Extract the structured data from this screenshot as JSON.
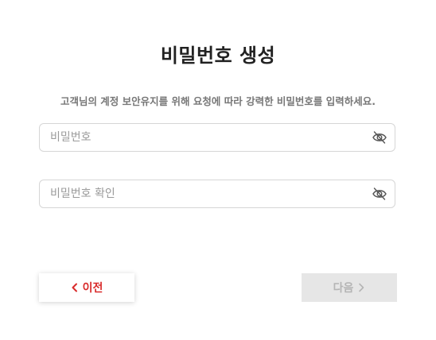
{
  "page": {
    "title": "비밀번호 생성",
    "subtitle": "고객님의 계정 보안유지를 위해 요청에 따라 강력한 비밀번호를 입력하세요."
  },
  "form": {
    "password": {
      "value": "",
      "placeholder": "비밀번호",
      "visibility_icon": "eye-off-icon"
    },
    "password_confirm": {
      "value": "",
      "placeholder": "비밀번호 확인",
      "visibility_icon": "eye-off-icon"
    }
  },
  "buttons": {
    "prev_label": "이전",
    "prev_icon": "chevron-left-icon",
    "next_label": "다음",
    "next_icon": "chevron-right-icon",
    "next_enabled": false
  },
  "colors": {
    "accent": "#d92b2b",
    "disabled_bg": "#e6e6e6",
    "disabled_text": "#b5b5b5",
    "border": "#d6d6d6"
  }
}
